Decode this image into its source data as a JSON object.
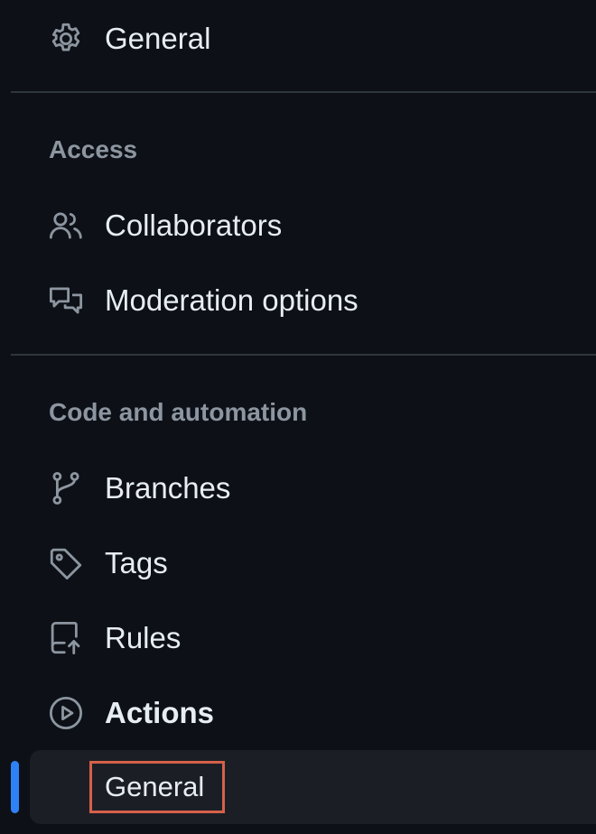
{
  "nav": {
    "general": {
      "label": "General",
      "icon": "gear-icon"
    },
    "sections": [
      {
        "heading": "Access",
        "items": [
          {
            "label": "Collaborators",
            "icon": "people-icon"
          },
          {
            "label": "Moderation options",
            "icon": "comment-discussion-icon"
          }
        ]
      },
      {
        "heading": "Code and automation",
        "items": [
          {
            "label": "Branches",
            "icon": "git-branch-icon"
          },
          {
            "label": "Tags",
            "icon": "tag-icon"
          },
          {
            "label": "Rules",
            "icon": "repo-push-icon"
          },
          {
            "label": "Actions",
            "icon": "play-icon"
          }
        ]
      }
    ],
    "actions_subitems": [
      {
        "label": "General",
        "selected": true
      }
    ]
  },
  "colors": {
    "background": "#0d1117",
    "text": "#e6edf3",
    "muted": "#8d96a0",
    "divider": "#30363d",
    "active_indicator": "#2f81f7",
    "selected_bg": "#1b1f25",
    "highlight_box": "#d6604a"
  }
}
